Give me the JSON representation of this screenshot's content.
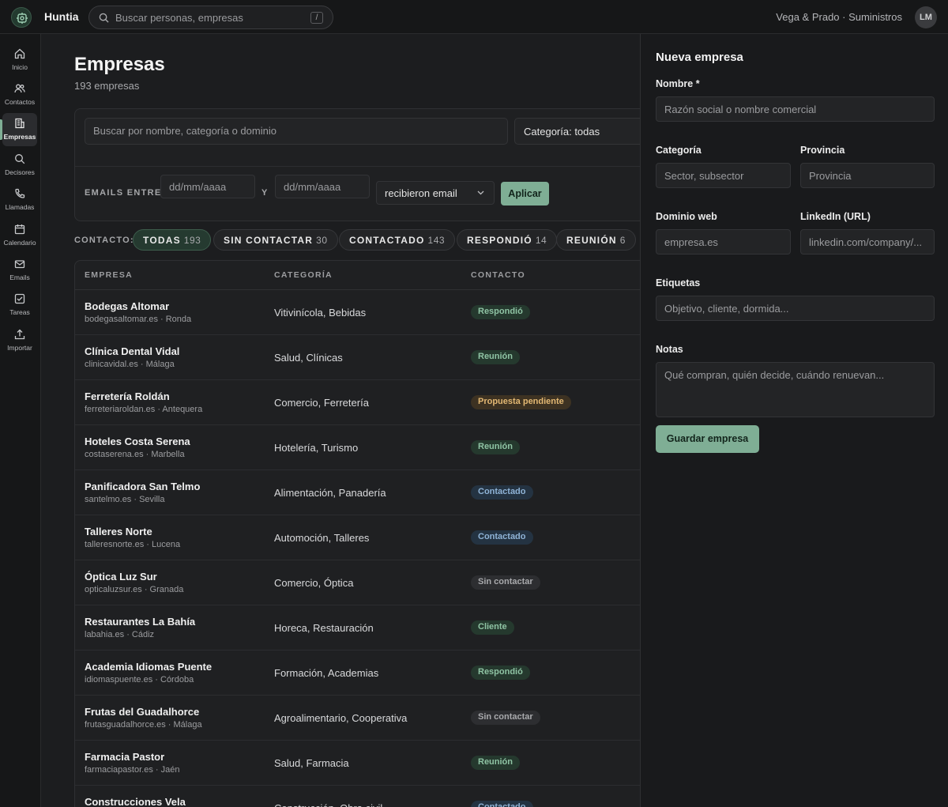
{
  "app": {
    "brand": "Huntia",
    "org": "Vega & Prado · Suministros",
    "avatar": "LM"
  },
  "global_search": {
    "placeholder": "Buscar personas, empresas",
    "shortcut": "/"
  },
  "sidebar": {
    "items": [
      {
        "label": "Inicio",
        "icon": "home-icon"
      },
      {
        "label": "Contactos",
        "icon": "users-icon"
      },
      {
        "label": "Empresas",
        "icon": "building-icon",
        "active": true
      },
      {
        "label": "Decisores",
        "icon": "search-icon"
      },
      {
        "label": "Llamadas",
        "icon": "phone-icon"
      },
      {
        "label": "Calendario",
        "icon": "calendar-icon"
      },
      {
        "label": "Emails",
        "icon": "mail-icon"
      },
      {
        "label": "Tareas",
        "icon": "checkbox-icon"
      },
      {
        "label": "Importar",
        "icon": "upload-icon"
      }
    ]
  },
  "page": {
    "title": "Empresas",
    "subtitle": "193 empresas"
  },
  "filters": {
    "search_placeholder": "Buscar por nombre, categoría o dominio",
    "category": "Categoría: todas",
    "emails_label": "EMAILS ENTRE",
    "date_from_placeholder": "dd/mm/aaaa",
    "and_label": "Y",
    "date_to_placeholder": "dd/mm/aaaa",
    "mode": "recibieron email",
    "apply": "Aplicar"
  },
  "contact_filter": {
    "label": "CONTACTO:",
    "pills": [
      {
        "label": "TODAS",
        "count": "193",
        "active": true
      },
      {
        "label": "SIN CONTACTAR",
        "count": "30"
      },
      {
        "label": "CONTACTADO",
        "count": "143"
      },
      {
        "label": "RESPONDIÓ",
        "count": "14"
      },
      {
        "label": "REUNIÓN",
        "count": "6"
      }
    ]
  },
  "table": {
    "headers": {
      "company": "EMPRESA",
      "category": "CATEGORÍA",
      "contact": "CONTACTO"
    },
    "rows": [
      {
        "name": "Bodegas Altomar",
        "meta": "bodegasaltomar.es · Ronda",
        "category": "Vitivinícola, Bebidas",
        "status": "Respondió",
        "status_kind": "respondio"
      },
      {
        "name": "Clínica Dental Vidal",
        "meta": "clinicavidal.es · Málaga",
        "category": "Salud, Clínicas",
        "status": "Reunión",
        "status_kind": "reunion"
      },
      {
        "name": "Ferretería Roldán",
        "meta": "ferreteriaroldan.es · Antequera",
        "category": "Comercio, Ferretería",
        "status": "Propuesta pendiente",
        "status_kind": "propuesta"
      },
      {
        "name": "Hoteles Costa Serena",
        "meta": "costaserena.es · Marbella",
        "category": "Hotelería, Turismo",
        "status": "Reunión",
        "status_kind": "reunion"
      },
      {
        "name": "Panificadora San Telmo",
        "meta": "santelmo.es · Sevilla",
        "category": "Alimentación, Panadería",
        "status": "Contactado",
        "status_kind": "contactado"
      },
      {
        "name": "Talleres Norte",
        "meta": "talleresnorte.es · Lucena",
        "category": "Automoción, Talleres",
        "status": "Contactado",
        "status_kind": "contactado"
      },
      {
        "name": "Óptica Luz Sur",
        "meta": "opticaluzsur.es · Granada",
        "category": "Comercio, Óptica",
        "status": "Sin contactar",
        "status_kind": "sin"
      },
      {
        "name": "Restaurantes La Bahía",
        "meta": "labahia.es · Cádiz",
        "category": "Horeca, Restauración",
        "status": "Cliente",
        "status_kind": "cliente"
      },
      {
        "name": "Academia Idiomas Puente",
        "meta": "idiomaspuente.es · Córdoba",
        "category": "Formación, Academias",
        "status": "Respondió",
        "status_kind": "respondio"
      },
      {
        "name": "Frutas del Guadalhorce",
        "meta": "frutasguadalhorce.es · Málaga",
        "category": "Agroalimentario, Cooperativa",
        "status": "Sin contactar",
        "status_kind": "sin"
      },
      {
        "name": "Farmacia Pastor",
        "meta": "farmaciapastor.es · Jaén",
        "category": "Salud, Farmacia",
        "status": "Reunión",
        "status_kind": "reunion"
      },
      {
        "name": "Construcciones Vela",
        "meta": "",
        "category": "Construcción, Obra civil",
        "status": "Contactado",
        "status_kind": "contactado"
      }
    ]
  },
  "status_colors": {
    "respondio": {
      "bg": "#25392e",
      "fg": "#8fc4a4"
    },
    "reunion": {
      "bg": "#25392e",
      "fg": "#8fc4a4"
    },
    "cliente": {
      "bg": "#25392e",
      "fg": "#8fc4a4"
    },
    "propuesta": {
      "bg": "#3d3222",
      "fg": "#e3b873"
    },
    "contactado": {
      "bg": "#243342",
      "fg": "#8fb3d6"
    },
    "sin": {
      "bg": "#2d2e31",
      "fg": "#a9aaad"
    }
  },
  "panel": {
    "title": "Nueva empresa",
    "name_label": "Nombre *",
    "name_placeholder": "Razón social o nombre comercial",
    "category_label": "Categoría",
    "category_placeholder": "Sector, subsector",
    "province_label": "Provincia",
    "province_placeholder": "Provincia",
    "domain_label": "Dominio web",
    "domain_placeholder": "empresa.es",
    "linkedin_label": "LinkedIn (URL)",
    "linkedin_placeholder": "linkedin.com/company/...",
    "tags_label": "Etiquetas",
    "tags_placeholder": "Objetivo, cliente, dormida...",
    "notes_label": "Notas",
    "notes_placeholder": "Qué compran, quién decide, cuándo renuevan...",
    "save": "Guardar empresa"
  }
}
